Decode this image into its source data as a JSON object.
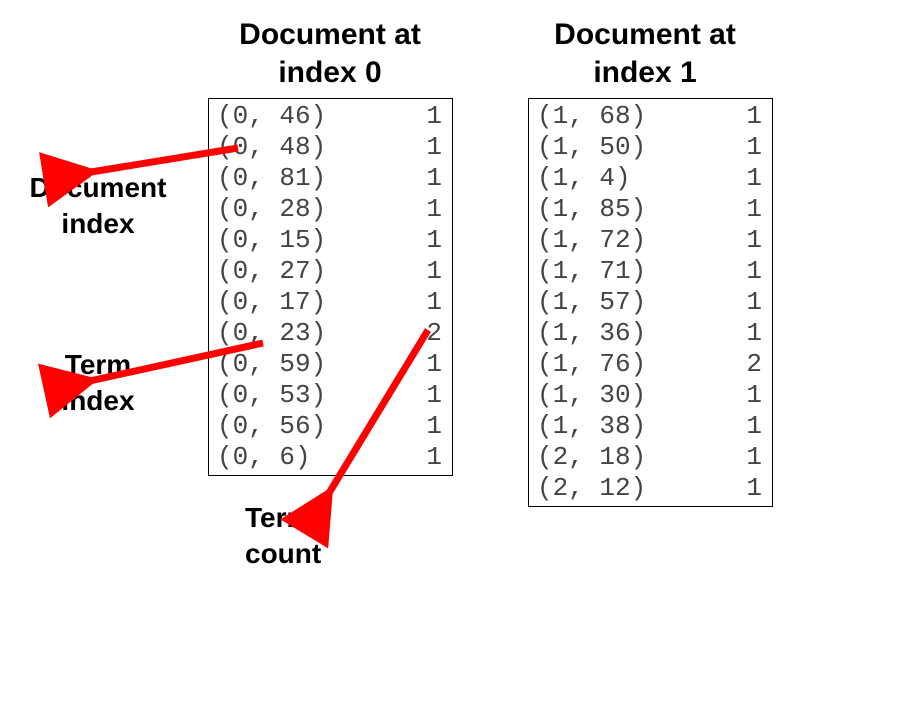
{
  "headers": {
    "doc0_line1": "Document at",
    "doc0_line2": "index 0",
    "doc1_line1": "Document at",
    "doc1_line2": "index 1"
  },
  "annotations": {
    "doc_index_line1": "Document",
    "doc_index_line2": "index",
    "term_index_line1": "Term",
    "term_index_line2": "index",
    "term_count_line1": "Term",
    "term_count_line2": "count"
  },
  "box0": [
    {
      "tuple": "(0, 46)",
      "count": "1"
    },
    {
      "tuple": "(0, 48)",
      "count": "1"
    },
    {
      "tuple": "(0, 81)",
      "count": "1"
    },
    {
      "tuple": "(0, 28)",
      "count": "1"
    },
    {
      "tuple": "(0, 15)",
      "count": "1"
    },
    {
      "tuple": "(0, 27)",
      "count": "1"
    },
    {
      "tuple": "(0, 17)",
      "count": "1"
    },
    {
      "tuple": "(0, 23)",
      "count": "2"
    },
    {
      "tuple": "(0, 59)",
      "count": "1"
    },
    {
      "tuple": "(0, 53)",
      "count": "1"
    },
    {
      "tuple": "(0, 56)",
      "count": "1"
    },
    {
      "tuple": "(0, 6)",
      "count": "1"
    }
  ],
  "box1": [
    {
      "tuple": "(1, 68)",
      "count": "1"
    },
    {
      "tuple": "(1, 50)",
      "count": "1"
    },
    {
      "tuple": "(1, 4)",
      "count": "1"
    },
    {
      "tuple": "(1, 85)",
      "count": "1"
    },
    {
      "tuple": "(1, 72)",
      "count": "1"
    },
    {
      "tuple": "(1, 71)",
      "count": "1"
    },
    {
      "tuple": "(1, 57)",
      "count": "1"
    },
    {
      "tuple": "(1, 36)",
      "count": "1"
    },
    {
      "tuple": "(1, 76)",
      "count": "2"
    },
    {
      "tuple": "(1, 30)",
      "count": "1"
    },
    {
      "tuple": "(1, 38)",
      "count": "1"
    },
    {
      "tuple": "(2, 18)",
      "count": "1"
    },
    {
      "tuple": "(2, 12)",
      "count": "1"
    }
  ]
}
